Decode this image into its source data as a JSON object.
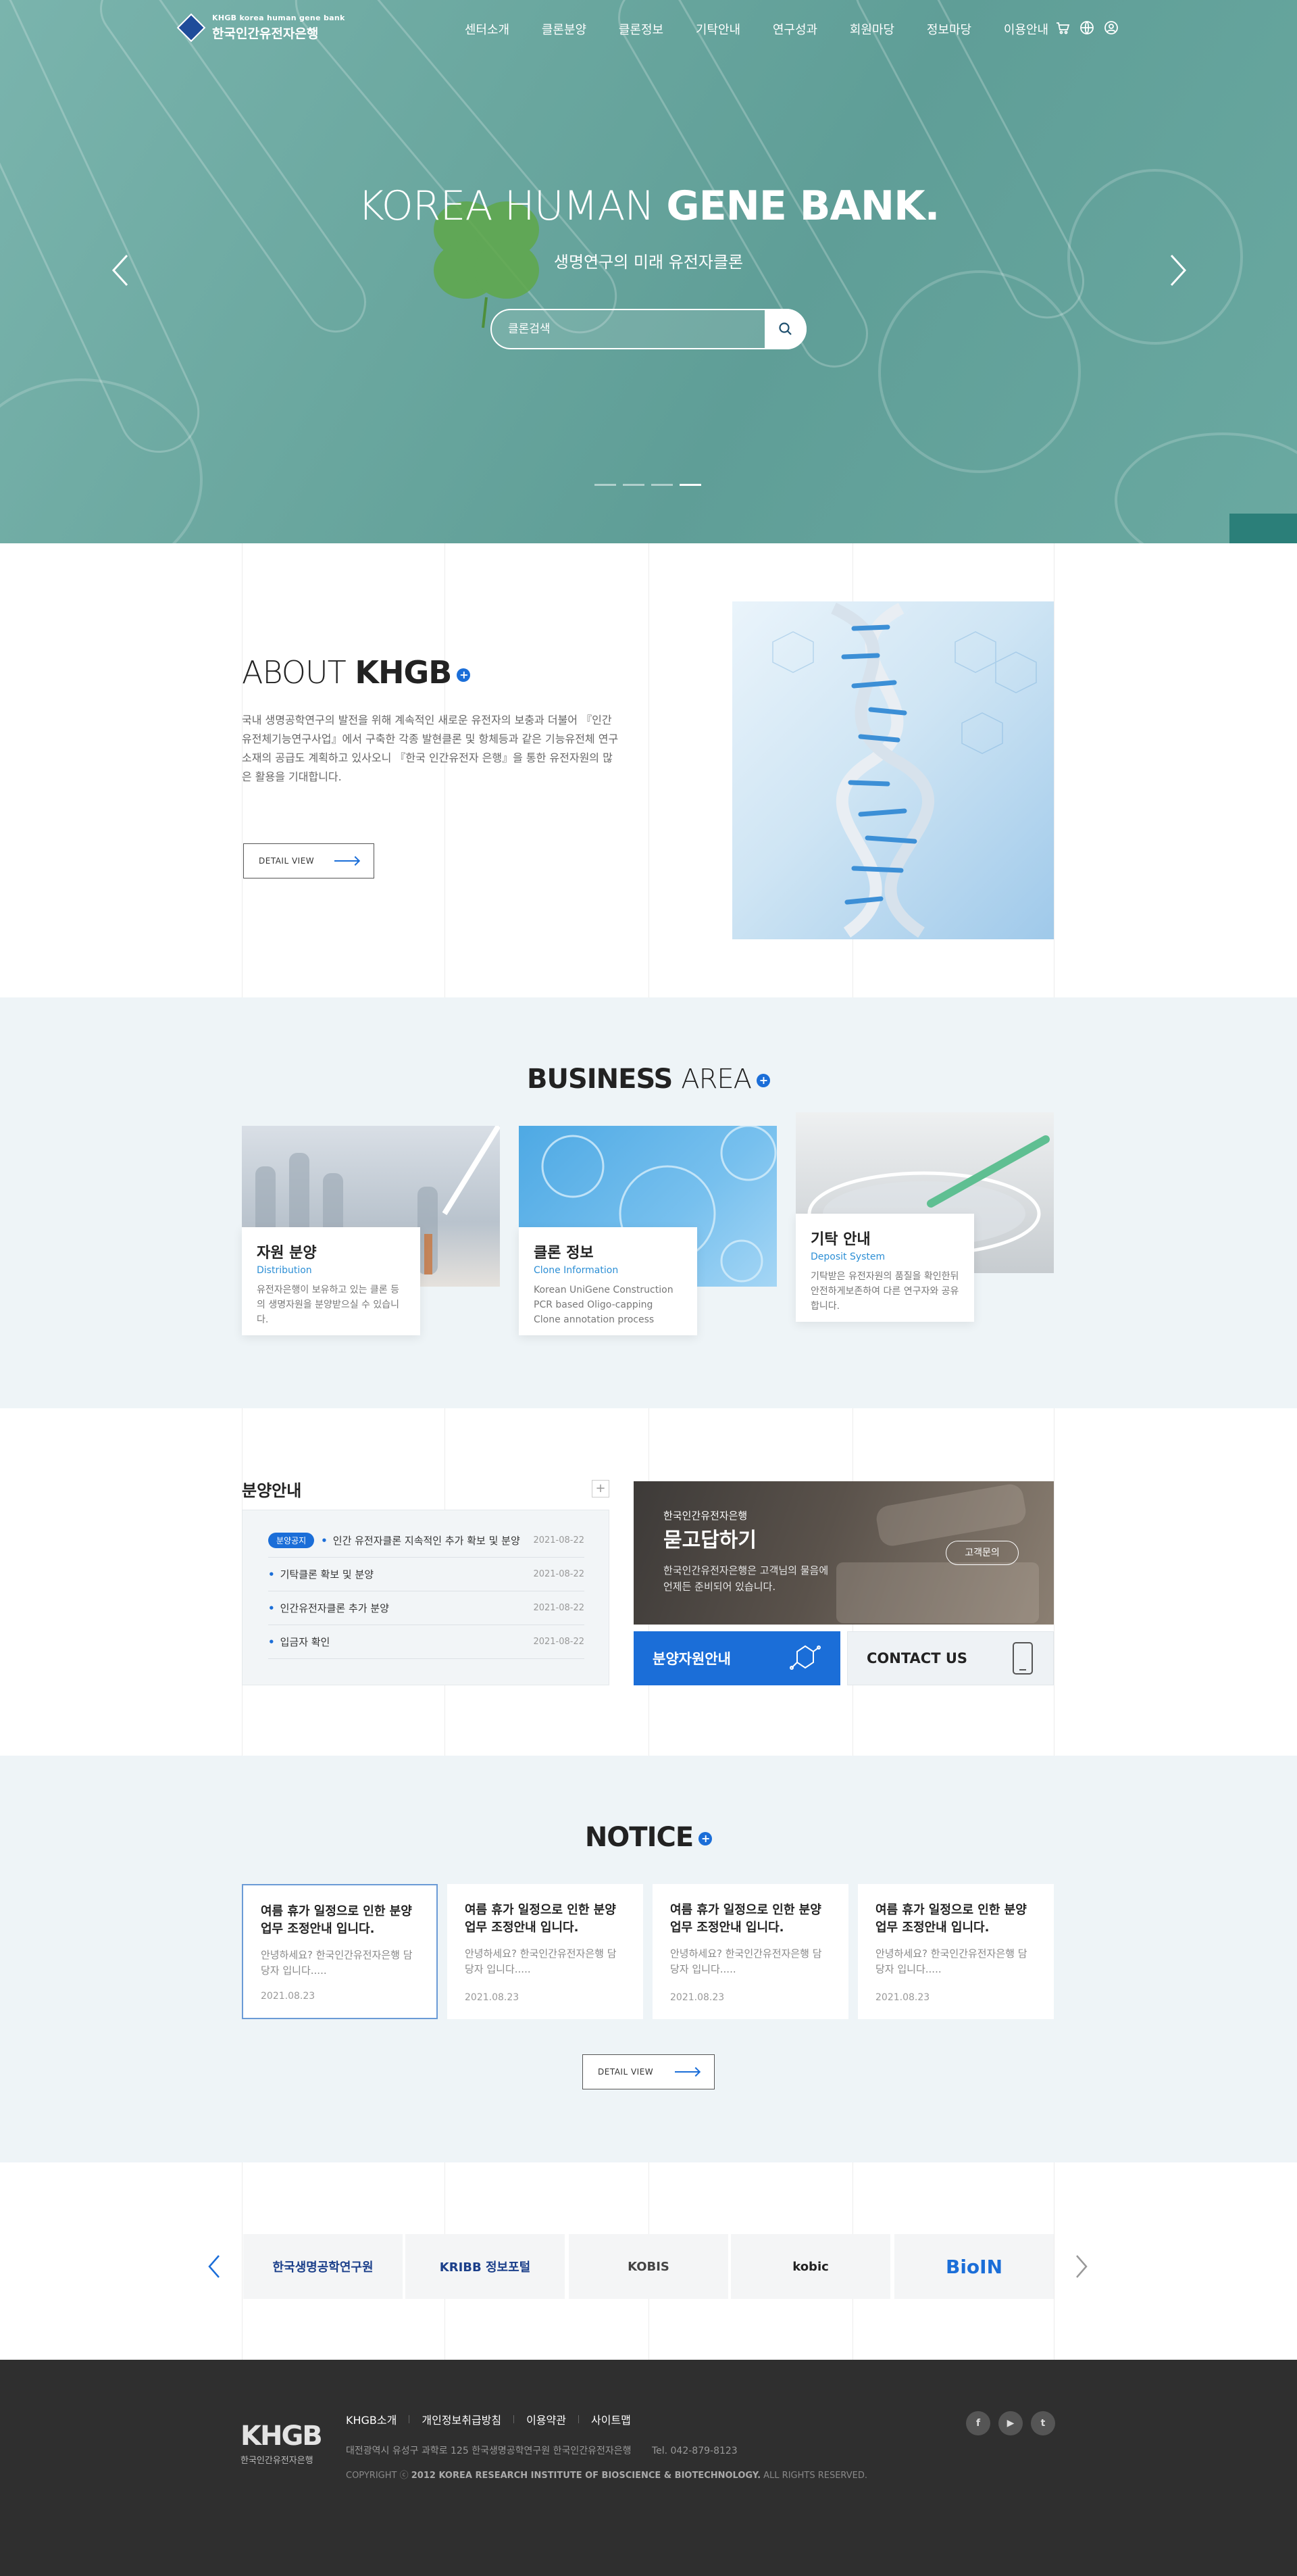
{
  "header": {
    "logo_sub": "KHGB  korea human gene bank",
    "logo_main": "한국인간유전자은행",
    "nav": [
      "센터소개",
      "클론분양",
      "클론정보",
      "기탁안내",
      "연구성과",
      "회원마당",
      "정보마당",
      "이용안내"
    ],
    "util_icons": [
      "cart-icon",
      "globe-icon",
      "user-icon"
    ]
  },
  "hero": {
    "title_light": "KOREA HUMAN",
    "title_bold": "GENE BANK.",
    "subtitle": "생명연구의 미래 유전자클론",
    "search_placeholder": "클론검색",
    "slides_total": 4,
    "slide_active": 4
  },
  "about": {
    "title_light": "ABOUT",
    "title_bold": "KHGB",
    "description": "국내 생명공학연구의 발전을 위해 계속적인 새로운 유전자의 보충과 더불어 『인간유전체기능연구사업』에서 구축한 각종 발현클론 및 항체등과 같은 기능유전체 연구소재의 공급도 계획하고 있사오니 『한국 인간유전자 은행』을 통한 유전자원의 많은 활용을 기대합니다.",
    "button": "DETAIL VIEW"
  },
  "business": {
    "title_bold": "BUSINESS",
    "title_light": "AREA",
    "cards": [
      {
        "title": "자원 분양",
        "en": "Distribution",
        "desc": "유전자은행이 보유하고 있는 클론 등의 생명자원을 분양받으실 수 있습니다."
      },
      {
        "title": "클론 정보",
        "en": "Clone Information",
        "desc": "Korean UniGene Construction PCR based Oligo-capping Clone annotation process"
      },
      {
        "title": "기탁 안내",
        "en": "Deposit System",
        "desc": "기탁받은 유전자원의 품질을 확인한뒤 안전하게보존하여 다른 연구자와 공유합니다."
      }
    ]
  },
  "distribution": {
    "title": "분양안내",
    "items": [
      {
        "badge": "분양공지",
        "text": "인간 유전자클론 지속적인 추가 확보 및 분양",
        "date": "2021-08-22"
      },
      {
        "badge": "",
        "text": "기탁클론 확보 및 분양",
        "date": "2021-08-22"
      },
      {
        "badge": "",
        "text": "인간유전자클론 추가 분양",
        "date": "2021-08-22"
      },
      {
        "badge": "",
        "text": "입금자 확인",
        "date": "2021-08-22"
      }
    ],
    "qna_small": "한국인간유전자은행",
    "qna_title": "묻고답하기",
    "qna_desc1": "한국인간유전자은행은 고객님의 물음에",
    "qna_desc2": "언제든 준비되어 있습니다.",
    "qna_button": "고객문의",
    "tile_blue": "분양자원안내",
    "tile_gray": "CONTACT US"
  },
  "notice": {
    "title": "NOTICE",
    "cards": [
      {
        "title": "여름 휴가 일정으로 인한 분양 업무 조정안내 입니다.",
        "desc": "안녕하세요? 한국인간유전자은행 담당자 입니다.....",
        "date": "2021.08.23"
      },
      {
        "title": "여름 휴가 일정으로 인한 분양 업무 조정안내 입니다.",
        "desc": "안녕하세요? 한국인간유전자은행 담당자 입니다.....",
        "date": "2021.08.23"
      },
      {
        "title": "여름 휴가 일정으로 인한 분양 업무 조정안내 입니다.",
        "desc": "안녕하세요? 한국인간유전자은행 담당자 입니다.....",
        "date": "2021.08.23"
      },
      {
        "title": "여름 휴가 일정으로 인한 분양 업무 조정안내 입니다.",
        "desc": "안녕하세요? 한국인간유전자은행 담당자 입니다.....",
        "date": "2021.08.23"
      }
    ],
    "button": "DETAIL VIEW"
  },
  "partners": [
    "한국생명공학연구원",
    "KRIBB 정보포털",
    "KOBIS",
    "kobic",
    "BioIN"
  ],
  "footer": {
    "logo": "KHGB",
    "logo_sub": "한국인간유전자은행",
    "links": [
      "KHGB소개",
      "개인정보취급방침",
      "이용약관",
      "사이트맵"
    ],
    "address": "대전광역시 유성구 과학로 125 한국생명공학연구원 한국인간유전자은행",
    "tel": "Tel. 042-879-8123",
    "copy_prefix": "COPYRIGHT ⓒ",
    "copy_bold": "2012 KOREA RESEARCH INSTITUTE OF BIOSCIENCE & BIOTECHNOLOGY.",
    "copy_suffix": "ALL RIGHTS RESERVED.",
    "sns": [
      "f",
      "▶",
      "t"
    ]
  },
  "colors": {
    "accent": "#1b6ed8",
    "hero": "#6aa79f",
    "footer": "#2f2f2f",
    "section_bg": "#eef4f7"
  }
}
